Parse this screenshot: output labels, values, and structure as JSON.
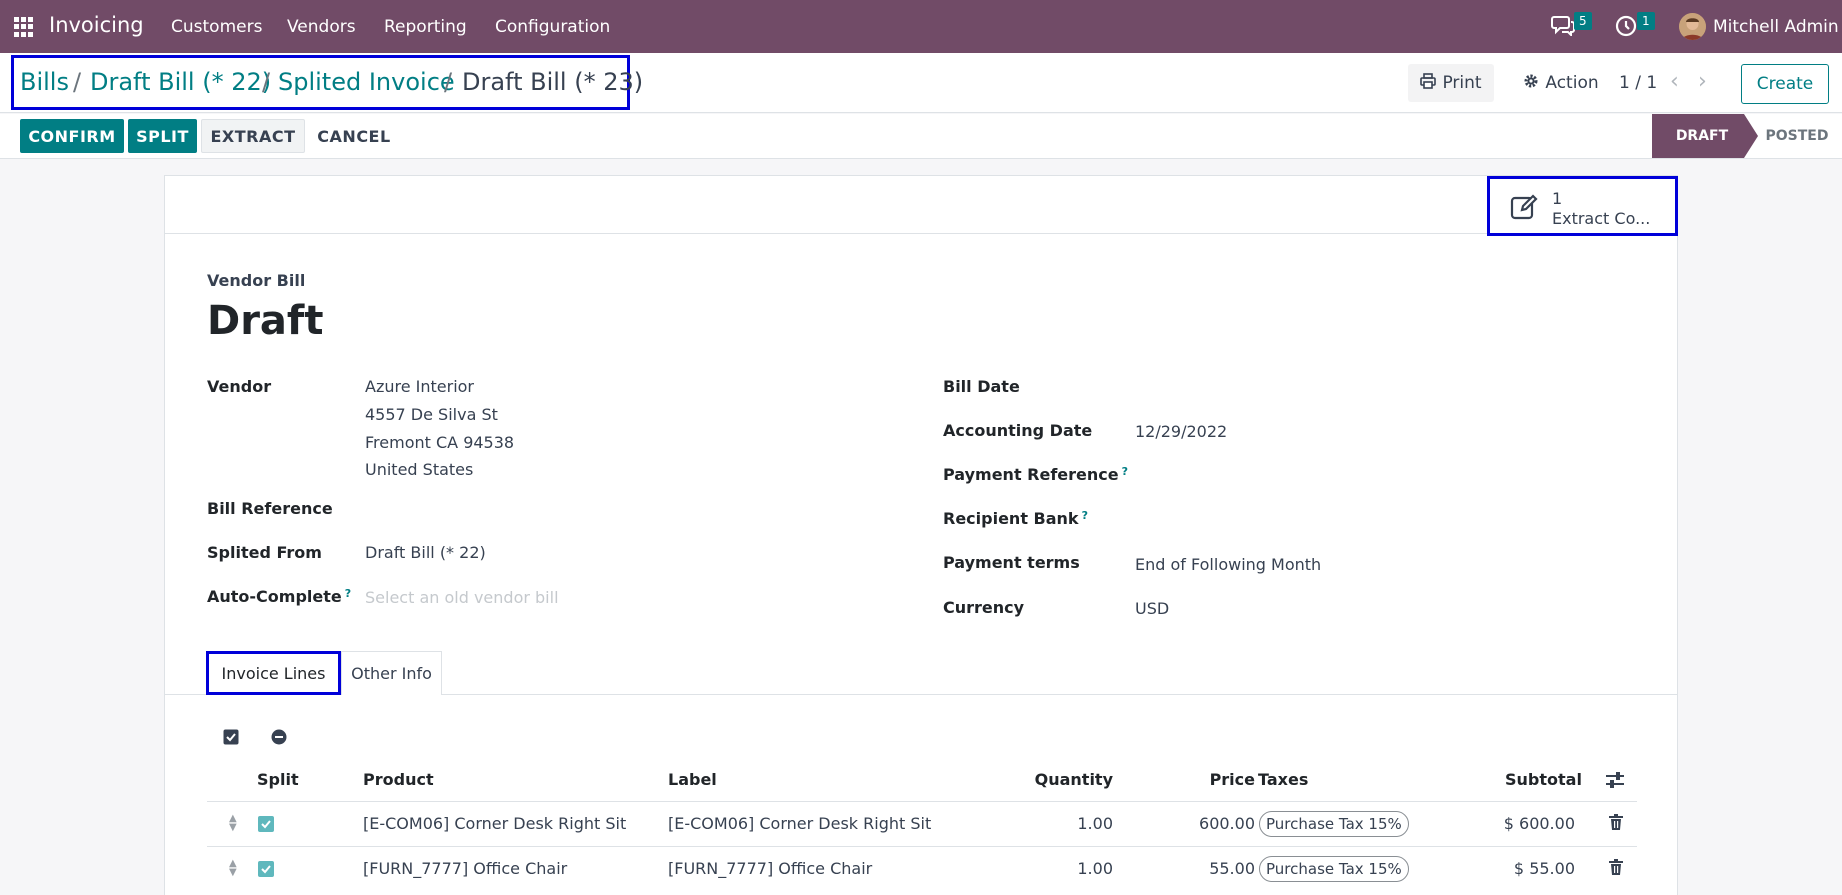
{
  "navbar": {
    "app_name": "Invoicing",
    "menu": [
      "Customers",
      "Vendors",
      "Reporting",
      "Configuration"
    ],
    "messages_count": "5",
    "activities_count": "1",
    "user_name": "Mitchell Admin"
  },
  "breadcrumbs": {
    "items": [
      "Bills",
      "Draft Bill (* 22)",
      "Splited Invoice"
    ],
    "current": "Draft Bill (* 23)",
    "separator": "/"
  },
  "toolbar": {
    "print_label": "Print",
    "action_label": "Action",
    "pager": "1 / 1",
    "create_label": "Create"
  },
  "statusbar": {
    "buttons": [
      "CONFIRM",
      "SPLIT",
      "EXTRACT",
      "CANCEL"
    ],
    "stages": [
      "DRAFT",
      "POSTED"
    ],
    "active_stage": "DRAFT"
  },
  "smart_button": {
    "count": "1",
    "label": "Extract Co..."
  },
  "form": {
    "subtitle": "Vendor Bill",
    "title": "Draft",
    "left": {
      "vendor_label": "Vendor",
      "vendor_address": [
        "Azure Interior",
        "4557 De Silva St",
        "Fremont CA 94538",
        "United States"
      ],
      "bill_reference_label": "Bill Reference",
      "splited_from_label": "Splited From",
      "splited_from_value": "Draft Bill (* 22)",
      "auto_complete_label": "Auto-Complete",
      "auto_complete_placeholder": "Select an old vendor bill"
    },
    "right": {
      "bill_date_label": "Bill Date",
      "accounting_date_label": "Accounting Date",
      "accounting_date_value": "12/29/2022",
      "payment_reference_label": "Payment Reference",
      "recipient_bank_label": "Recipient Bank",
      "payment_terms_label": "Payment terms",
      "payment_terms_value": "End of Following Month",
      "currency_label": "Currency",
      "currency_value": "USD"
    },
    "help_mark": "?"
  },
  "tabs": [
    "Invoice Lines",
    "Other Info"
  ],
  "invoice_lines": {
    "columns": [
      "Split",
      "Product",
      "Label",
      "Quantity",
      "Price",
      "Taxes",
      "Subtotal"
    ],
    "rows": [
      {
        "product": "[E-COM06] Corner Desk Right Sit",
        "label": "[E-COM06] Corner Desk Right Sit",
        "quantity": "1.00",
        "price": "600.00",
        "tax": "Purchase Tax 15%",
        "subtotal": "$ 600.00",
        "split": true
      },
      {
        "product": "[FURN_7777] Office Chair",
        "label": "[FURN_7777] Office Chair",
        "quantity": "1.00",
        "price": "55.00",
        "tax": "Purchase Tax 15%",
        "subtotal": "$ 55.00",
        "split": true
      }
    ]
  },
  "colors": {
    "brand": "#714b67",
    "accent": "#017e84",
    "highlight_box": "#0000d9"
  }
}
